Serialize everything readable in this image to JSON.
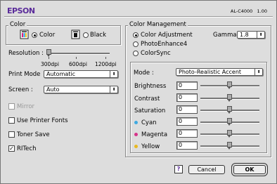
{
  "header": {
    "brand": "EPSON",
    "model": "AL-C4000",
    "version": "1.00"
  },
  "color_group": {
    "title": "Color",
    "options": [
      {
        "label": "Color",
        "selected": true
      },
      {
        "label": "Black",
        "selected": false
      }
    ]
  },
  "resolution": {
    "label": "Resolution :",
    "ticks": [
      "300dpi",
      "600dpi",
      "1200dpi"
    ],
    "value": "300dpi"
  },
  "print_mode": {
    "label": "Print Mode",
    "value": "Automatic"
  },
  "screen": {
    "label": "Screen :",
    "value": "Auto"
  },
  "checkboxes": [
    {
      "label": "Mirror",
      "checked": false,
      "disabled": true
    },
    {
      "label": "Use Printer Fonts",
      "checked": false,
      "disabled": false
    },
    {
      "label": "Toner Save",
      "checked": false,
      "disabled": false
    },
    {
      "label": "RITech",
      "checked": true,
      "disabled": false
    }
  ],
  "color_management": {
    "title": "Color Management",
    "options": [
      {
        "label": "Color Adjustment",
        "selected": true
      },
      {
        "label": "PhotoEnhance4",
        "selected": false
      },
      {
        "label": "ColorSync",
        "selected": false
      }
    ],
    "gamma": {
      "label": "Gamma",
      "value": "1.8"
    },
    "mode": {
      "label": "Mode :",
      "value": "Photo-Realistic Accent"
    },
    "adjustments": [
      {
        "label": "Brightness",
        "value": "0",
        "dot_color": ""
      },
      {
        "label": "Contrast",
        "value": "0",
        "dot_color": ""
      },
      {
        "label": "Saturation",
        "value": "0",
        "dot_color": ""
      },
      {
        "label": "Cyan",
        "value": "0",
        "dot_color": "#3fa9e0"
      },
      {
        "label": "Magenta",
        "value": "0",
        "dot_color": "#d6338a"
      },
      {
        "label": "Yellow",
        "value": "0",
        "dot_color": "#e8b820"
      }
    ]
  },
  "buttons": {
    "help": "?",
    "cancel": "Cancel",
    "ok": "OK"
  },
  "colors": {
    "brand": "#5a2b9a",
    "background": "#dddddd"
  }
}
